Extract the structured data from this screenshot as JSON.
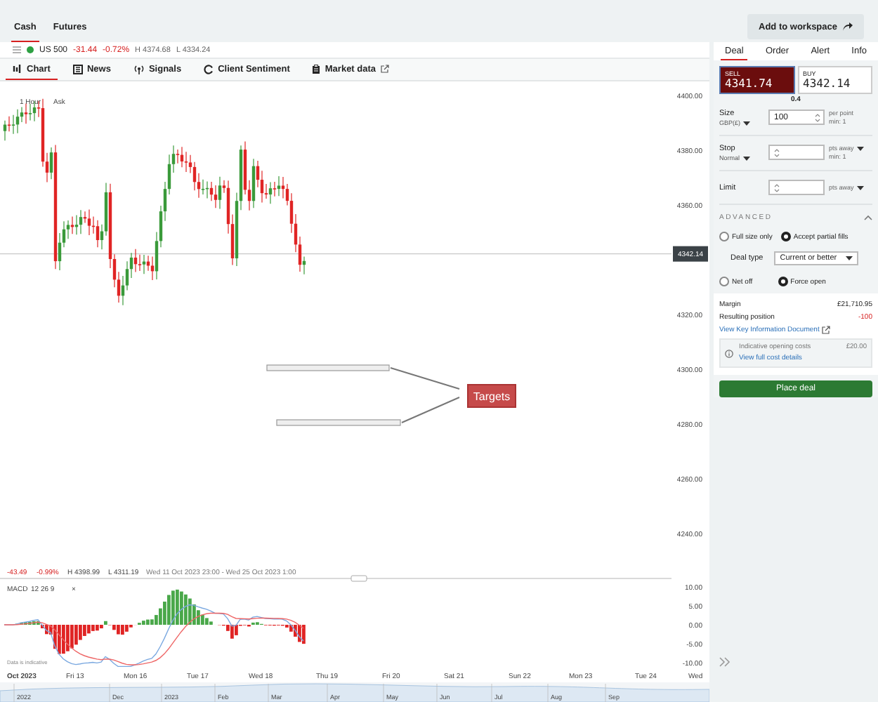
{
  "header": {
    "tabs": [
      {
        "label": "Cash",
        "selected": true
      },
      {
        "label": "Futures",
        "selected": false
      }
    ],
    "workspace_button": "Add to workspace"
  },
  "instrument": {
    "market_open": true,
    "name": "US 500",
    "change": "-31.44",
    "change_pct": "-0.72%",
    "high": "H 4374.68",
    "low": "L 4334.24"
  },
  "chart_tabs": [
    {
      "label": "Chart",
      "selected": true
    },
    {
      "label": "News",
      "selected": false
    },
    {
      "label": "Signals",
      "selected": false
    },
    {
      "label": "Client Sentiment",
      "selected": false
    },
    {
      "label": "Market data",
      "external": true,
      "selected": false
    }
  ],
  "chart": {
    "interval": "1 Hour",
    "price_type": "Ask",
    "y_axis_labels": [
      "4400.00",
      "4380.00",
      "4360.00",
      "4320.00",
      "4300.00",
      "4280.00",
      "4260.00",
      "4240.00"
    ],
    "current_price": "4342.14",
    "annotation": {
      "label": "Targets"
    },
    "summary": {
      "change": "-43.49",
      "change_pct": "-0.99%",
      "high": "H 4398.99",
      "low": "L 4311.19",
      "range": "Wed 11 Oct 2023 23:00 - Wed 25 Oct 2023 1:00"
    },
    "indicator": {
      "name": "MACD",
      "params": "12 26 9",
      "close": "×",
      "y_axis_labels": [
        "10.00",
        "5.00",
        "0.00",
        "-5.00",
        "-10.00"
      ]
    },
    "disclaimer": "Data is indicative",
    "time_axis": [
      {
        "label": "Oct 2023",
        "major": true
      },
      {
        "label": "Fri 13",
        "major": false
      },
      {
        "label": "Mon 16",
        "major": false
      },
      {
        "label": "Tue 17",
        "major": false
      },
      {
        "label": "Wed 18",
        "major": false
      },
      {
        "label": "Thu 19",
        "major": false
      },
      {
        "label": "Fri 20",
        "major": false
      },
      {
        "label": "Sat 21",
        "major": false
      },
      {
        "label": "Sun 22",
        "major": false
      },
      {
        "label": "Mon 23",
        "major": false
      },
      {
        "label": "Tue 24",
        "major": false
      },
      {
        "label": "Wed",
        "major": false
      }
    ],
    "navigator_labels": [
      "2022",
      "Dec",
      "2023",
      "Feb",
      "Mar",
      "Apr",
      "May",
      "Jun",
      "Jul",
      "Aug",
      "Sep"
    ]
  },
  "deal_panel": {
    "tabs": [
      {
        "label": "Deal",
        "selected": true
      },
      {
        "label": "Order",
        "selected": false
      },
      {
        "label": "Alert",
        "selected": false
      },
      {
        "label": "Info",
        "selected": false
      }
    ],
    "sell": {
      "label": "SELL",
      "price": "4341.74",
      "selected": true
    },
    "buy": {
      "label": "BUY",
      "price": "4342.14",
      "selected": false
    },
    "spread": "0.4",
    "size": {
      "label": "Size",
      "currency": "GBP(£)",
      "value": "100",
      "unit": "per point",
      "min": "min: 1"
    },
    "stop": {
      "label": "Stop",
      "type": "Normal",
      "unit": "pts away",
      "min": "min: 1"
    },
    "limit": {
      "label": "Limit",
      "unit": "pts away"
    },
    "advanced": {
      "title": "ADVANCED",
      "expanded": true,
      "fill_options": [
        {
          "label": "Full size only",
          "selected": false
        },
        {
          "label": "Accept partial fills",
          "selected": true
        }
      ],
      "deal_type_label": "Deal type",
      "deal_type": "Current or better",
      "position_options": [
        {
          "label": "Net off",
          "selected": false
        },
        {
          "label": "Force open",
          "selected": true
        }
      ]
    },
    "margin": {
      "label": "Margin",
      "value": "£21,710.95"
    },
    "resulting_position": {
      "label": "Resulting position",
      "value": "-100"
    },
    "kid_link": "View Key Information Document",
    "costs": {
      "label": "Indicative opening costs",
      "value": "£20.00",
      "link": "View full cost details"
    },
    "place_button": "Place deal"
  }
}
